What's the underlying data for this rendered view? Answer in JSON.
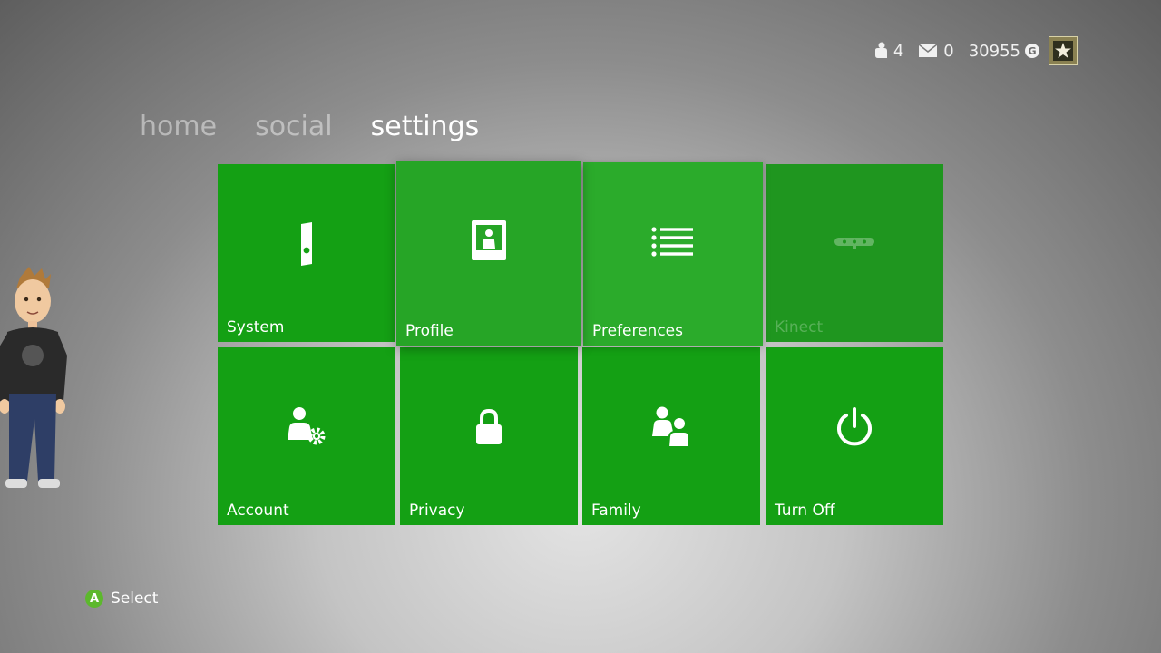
{
  "status": {
    "friends_online": "4",
    "messages": "0",
    "gamerscore": "30955",
    "gamerscore_badge": "G"
  },
  "nav": {
    "home": "home",
    "social": "social",
    "settings": "settings",
    "active": "settings"
  },
  "tiles": [
    {
      "label": "System",
      "icon": "console-icon"
    },
    {
      "label": "Profile",
      "icon": "profile-card-icon"
    },
    {
      "label": "Preferences",
      "icon": "list-icon"
    },
    {
      "label": "Kinect",
      "icon": "kinect-sensor-icon"
    },
    {
      "label": "Account",
      "icon": "account-gear-icon"
    },
    {
      "label": "Privacy",
      "icon": "lock-icon"
    },
    {
      "label": "Family",
      "icon": "family-icon"
    },
    {
      "label": "Turn Off",
      "icon": "power-icon"
    }
  ],
  "hint": {
    "button": "A",
    "action": "Select"
  },
  "colors": {
    "tile": "#14a014",
    "tile_focused": "#26a526",
    "a_button": "#5cb82c"
  }
}
